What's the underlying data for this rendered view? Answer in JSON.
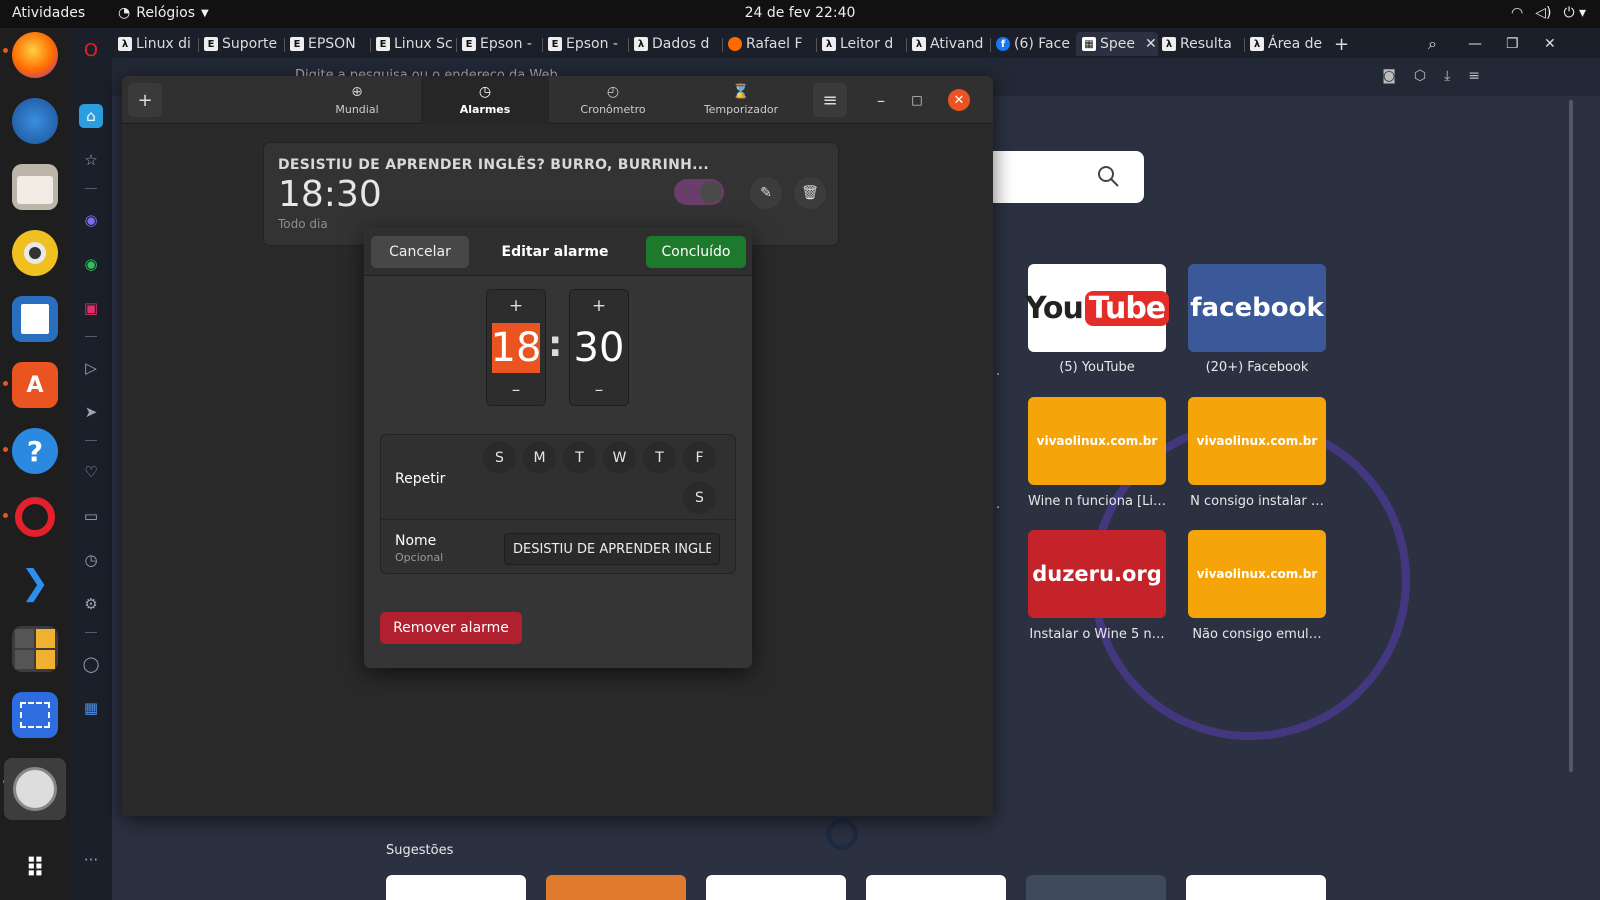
{
  "topbar": {
    "activities": "Atividades",
    "app_menu": "Relógios",
    "datetime": "24 de fev  22:40",
    "tray": [
      "wifi-icon",
      "volume-icon",
      "power-icon"
    ]
  },
  "browser": {
    "tabs": [
      "Linux di",
      "Suporte",
      "EPSON",
      "Linux Sc",
      "Epson -",
      "Epson -",
      "Dados d",
      "Rafael F",
      "Leitor d",
      "Ativand",
      "(6) Face",
      "Spee",
      "Resulta",
      "Área de"
    ],
    "address_placeholder": "Digite a pesquisa ou o endereço da Web",
    "speed_dial": [
      {
        "label": "(5) YouTube",
        "brand_text": "YouTube",
        "bg": "#ffffff",
        "color": "#ff0000"
      },
      {
        "label": "(20+) Facebook",
        "brand_text": "facebook",
        "bg": "#3b5998",
        "color": "#ffffff"
      },
      {
        "label": "Wine n funciona [Li…",
        "brand_text": "vivaolinux.com.br",
        "bg": "#f5a50a",
        "color": "#ffffff"
      },
      {
        "label": "N consigo instalar …",
        "brand_text": "vivaolinux.com.br",
        "bg": "#f5a50a",
        "color": "#ffffff"
      },
      {
        "label": "Instalar o Wine 5 n…",
        "brand_text": "duzeru.org",
        "bg": "#c4232a",
        "color": "#ffffff"
      },
      {
        "label": "Não consigo emul…",
        "brand_text": "vivaolinux.com.br",
        "bg": "#f5a50a",
        "color": "#ffffff"
      }
    ],
    "suggestions_label": "Sugestões"
  },
  "clocks": {
    "tabs": [
      {
        "label": "Mundial",
        "icon": "globe-icon"
      },
      {
        "label": "Alarmes",
        "icon": "alarm-icon"
      },
      {
        "label": "Cronômetro",
        "icon": "stopwatch-icon"
      },
      {
        "label": "Temporizador",
        "icon": "hourglass-icon"
      }
    ],
    "alarm": {
      "title": "DESISTIU DE APRENDER INGLÊS? BURRO, BURRINH...",
      "time": "18:30",
      "repeat": "Todo dia",
      "enabled": true
    }
  },
  "dialog": {
    "cancel": "Cancelar",
    "title": "Editar alarme",
    "done": "Concluído",
    "hour": "18",
    "minute": "30",
    "colon": ":",
    "plus": "+",
    "minus": "–",
    "repeat_label": "Repetir",
    "days": [
      "S",
      "M",
      "T",
      "W",
      "T",
      "F",
      "S"
    ],
    "name_label": "Nome",
    "name_sub": "Opcional",
    "name_value": "DESISTIU DE APRENDER INGLÊS? BURRO, BURRINHO",
    "remove": "Remover alarme"
  },
  "colors": {
    "accent_orange": "#e95420",
    "done_green": "#1d7a2c",
    "remove_red": "#b0202e"
  }
}
